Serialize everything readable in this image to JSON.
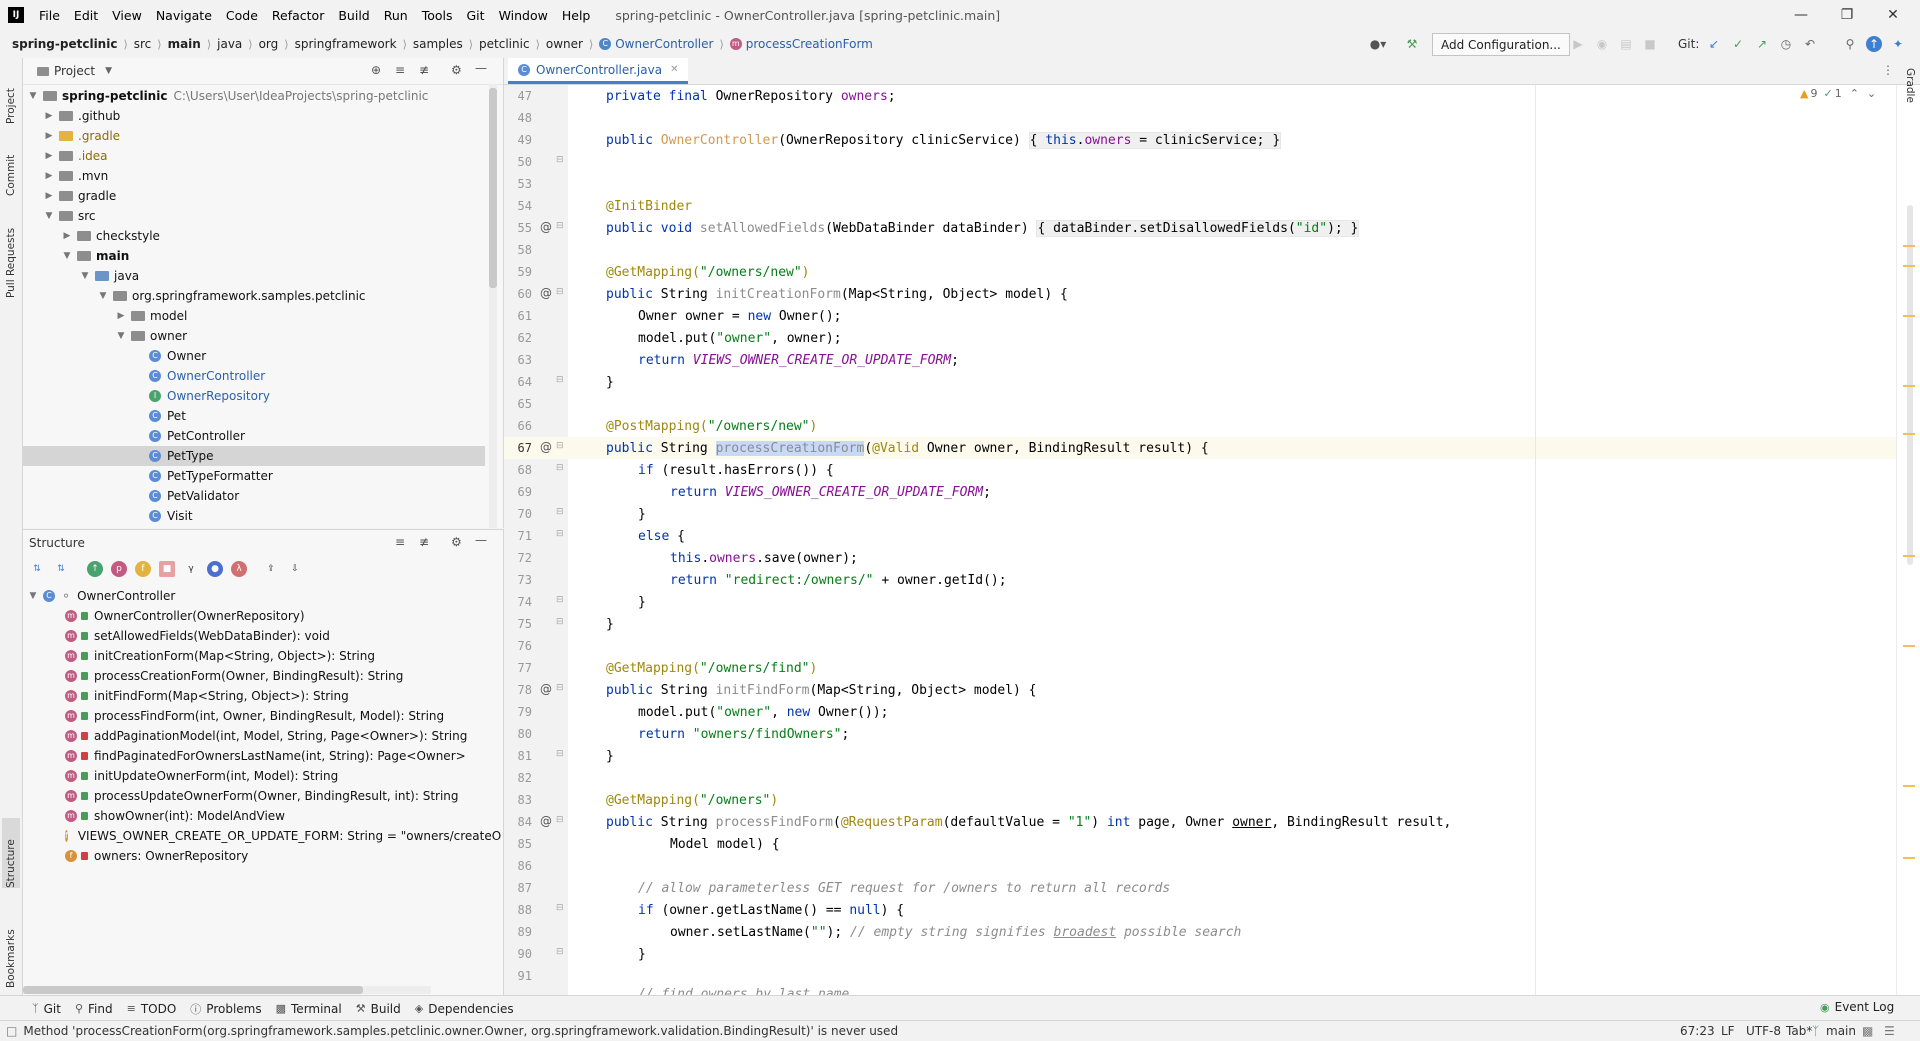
{
  "window": {
    "app_logo": "IJ",
    "title": "spring-petclinic - OwnerController.java [spring-petclinic.main]",
    "menu": [
      "File",
      "Edit",
      "View",
      "Navigate",
      "Code",
      "Refactor",
      "Build",
      "Run",
      "Tools",
      "Git",
      "Window",
      "Help"
    ]
  },
  "breadcrumb": [
    "spring-petclinic",
    "src",
    "main",
    "java",
    "org",
    "springframework",
    "samples",
    "petclinic",
    "owner",
    "OwnerController",
    "processCreationForm"
  ],
  "toolbar": {
    "add_config": "Add Configuration...",
    "git_label": "Git:"
  },
  "left_strip": {
    "project": "Project",
    "commit": "Commit",
    "pull_requests": "Pull Requests",
    "structure": "Structure",
    "bookmarks": "Bookmarks"
  },
  "right_strip": {
    "gradle": "Gradle"
  },
  "project_panel": {
    "title": "Project",
    "root": {
      "name": "spring-petclinic",
      "path": "C:\\Users\\User\\IdeaProjects\\spring-petclinic"
    },
    "items": [
      ".github",
      ".gradle",
      ".idea",
      ".mvn",
      "gradle",
      "src",
      "checkstyle",
      "main",
      "java",
      "org.springframework.samples.petclinic",
      "model",
      "owner",
      "Owner",
      "OwnerController",
      "OwnerRepository",
      "Pet",
      "PetController",
      "PetType",
      "PetTypeFormatter",
      "PetValidator",
      "Visit"
    ]
  },
  "structure_panel": {
    "title": "Structure",
    "root": "OwnerController",
    "items": [
      "OwnerController(OwnerRepository)",
      "setAllowedFields(WebDataBinder): void",
      "initCreationForm(Map<String, Object>): String",
      "processCreationForm(Owner, BindingResult): String",
      "initFindForm(Map<String, Object>): String",
      "processFindForm(int, Owner, BindingResult, Model): String",
      "addPaginationModel(int, Model, String, Page<Owner>): String",
      "findPaginatedForOwnersLastName(int, String): Page<Owner>",
      "initUpdateOwnerForm(int, Model): String",
      "processUpdateOwnerForm(Owner, BindingResult, int): String",
      "showOwner(int): ModelAndView",
      "VIEWS_OWNER_CREATE_OR_UPDATE_FORM: String = \"owners/createOrUpda",
      "owners: OwnerRepository"
    ]
  },
  "editor": {
    "tab": "OwnerController.java",
    "inspections": {
      "warnings": "9",
      "weak": "1"
    },
    "line_numbers": [
      "47",
      "48",
      "49",
      "50",
      "53",
      "54",
      "55",
      "58",
      "59",
      "60",
      "61",
      "62",
      "63",
      "64",
      "65",
      "66",
      "67",
      "68",
      "69",
      "70",
      "71",
      "72",
      "73",
      "74",
      "75",
      "76",
      "77",
      "78",
      "79",
      "80",
      "81",
      "82",
      "83",
      "84",
      "85",
      "86",
      "87",
      "88",
      "89",
      "90",
      "91"
    ],
    "code": {
      "l48": [
        "private final ",
        "OwnerRepository ",
        "owners",
        ";"
      ],
      "l50": [
        "public ",
        "OwnerController",
        "(OwnerRepository clinicService) ",
        "{ ",
        "this",
        ".",
        "owners",
        " = clinicService; ",
        "}"
      ],
      "l54": "@InitBinder",
      "l55": [
        "public void ",
        "setAllowedFields",
        "(WebDataBinder dataBinder) ",
        "{ dataBinder.setDisallowedFields(",
        "\"id\"",
        "); }"
      ],
      "l59": [
        "@GetMapping(",
        "\"/owners/new\"",
        ")"
      ],
      "l60": [
        "public ",
        "String ",
        "initCreationForm",
        "(Map<String, Object> model) {"
      ],
      "l61": [
        "Owner owner = ",
        "new ",
        "Owner();"
      ],
      "l62": [
        "model.put(",
        "\"owner\"",
        ", owner);"
      ],
      "l63": [
        "return ",
        "VIEWS_OWNER_CREATE_OR_UPDATE_FORM",
        ";"
      ],
      "l64": "}",
      "l66": [
        "@PostMapping(",
        "\"/owners/new\"",
        ")"
      ],
      "l67": [
        "public ",
        "String ",
        "processCreationForm",
        "(",
        "@Valid",
        " Owner owner, BindingResult result) {"
      ],
      "l68": [
        "if ",
        "(result.hasErrors()) {"
      ],
      "l69": [
        "return ",
        "VIEWS_OWNER_CREATE_OR_UPDATE_FORM",
        ";"
      ],
      "l70": "}",
      "l71": [
        "else ",
        "{"
      ],
      "l72": [
        "this",
        ".",
        "owners",
        ".save(owner);"
      ],
      "l73": [
        "return ",
        "\"redirect:/owners/\"",
        " + owner.getId();"
      ],
      "l74": "}",
      "l75": "}",
      "l77": [
        "@GetMapping(",
        "\"/owners/find\"",
        ")"
      ],
      "l78": [
        "public ",
        "String ",
        "initFindForm",
        "(Map<String, Object> model) {"
      ],
      "l79": [
        "model.put(",
        "\"owner\"",
        ", ",
        "new ",
        "Owner());"
      ],
      "l80": [
        "return ",
        "\"owners/findOwners\"",
        ";"
      ],
      "l81": "}",
      "l83": [
        "@GetMapping(",
        "\"/owners\"",
        ")"
      ],
      "l84": [
        "public ",
        "String ",
        "processFindForm",
        "(",
        "@RequestParam",
        "(defaultValue = ",
        "\"1\"",
        ") ",
        "int ",
        "page, Owner ",
        "owner",
        ", BindingResult result,"
      ],
      "l85": "Model model) {",
      "l87": "// allow parameterless GET request for /owners to return all records",
      "l88": [
        "if ",
        "(owner.getLastName() == ",
        "null",
        ") {"
      ],
      "l89": [
        "owner.setLastName(",
        "\"\"",
        "); ",
        "// empty string signifies ",
        "broadest",
        " possible search"
      ],
      "l90": "}",
      "l91": "// find owners by last name"
    }
  },
  "bottom_tabs": [
    "Git",
    "Find",
    "TODO",
    "Problems",
    "Terminal",
    "Build",
    "Dependencies"
  ],
  "event_log": "Event Log",
  "status": {
    "message": "Method 'processCreationForm(org.springframework.samples.petclinic.owner.Owner, org.springframework.validation.BindingResult)' is never used",
    "position": "67:23",
    "line_sep": "LF",
    "encoding": "UTF-8",
    "indent": "Tab*",
    "branch": "main"
  }
}
